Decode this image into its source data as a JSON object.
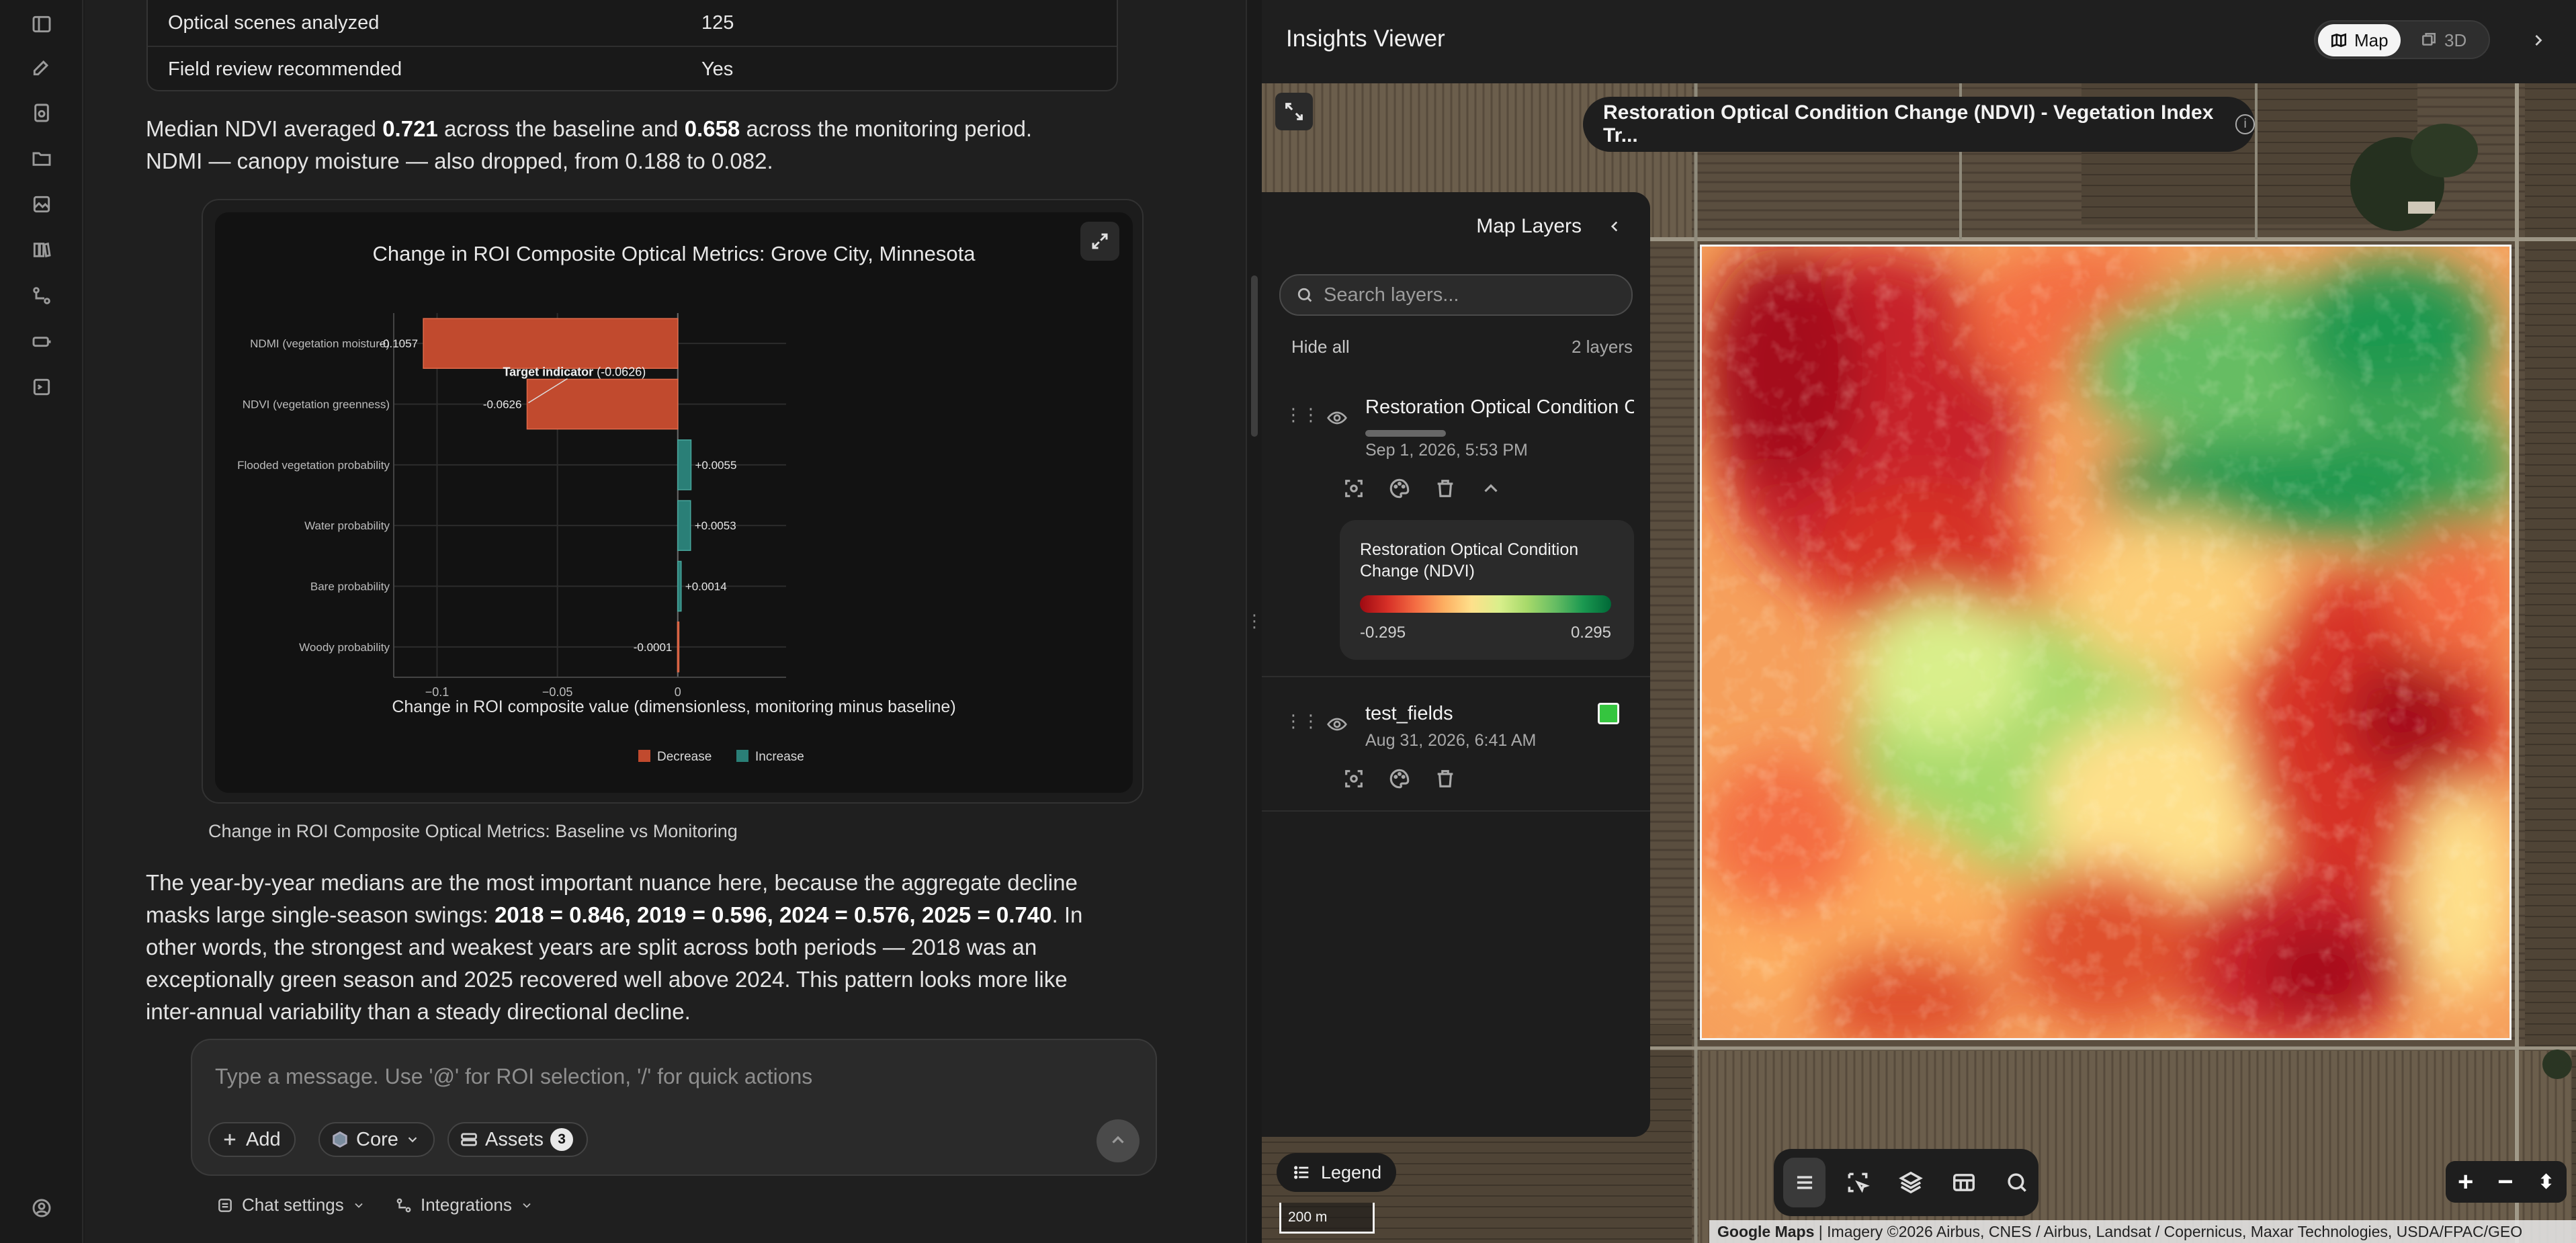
{
  "stats_table": {
    "rows": [
      {
        "label": "Optical scenes analyzed",
        "value": "125"
      },
      {
        "label": "Field review recommended",
        "value": "Yes"
      }
    ]
  },
  "paragraph1": {
    "p1": "Median NDVI averaged ",
    "b1": "0.721",
    "p2": " across the baseline and ",
    "b2": "0.658",
    "p3": " across the monitoring period.",
    "line2": "NDMI — canopy moisture — also dropped, from 0.188 to 0.082."
  },
  "chart_data": {
    "type": "bar",
    "orientation": "horizontal",
    "title": "Change in ROI Composite Optical Metrics: Grove City, Minnesota",
    "xlabel": "Change in ROI composite value (dimensionless, monitoring minus baseline)",
    "ylabel": "",
    "xlim": [
      -0.118,
      0.045
    ],
    "x_ticks": [
      -0.1,
      -0.05,
      0
    ],
    "x_tick_labels": [
      "−0.1",
      "−0.05",
      "0"
    ],
    "categories": [
      "NDMI (vegetation moisture)",
      "NDVI (vegetation greenness)",
      "Flooded vegetation probability",
      "Water probability",
      "Bare probability",
      "Woody probability"
    ],
    "values": [
      -0.1057,
      -0.0626,
      0.0055,
      0.0053,
      0.0014,
      -0.0001
    ],
    "value_labels": [
      "-0.1057",
      "-0.0626",
      "+0.0055",
      "+0.0053",
      "+0.0014",
      "-0.0001"
    ],
    "annotation": {
      "bold": "Target indicator",
      "rest": " (-0.0626)",
      "category": "NDVI (vegetation greenness)"
    },
    "legend": [
      {
        "name": "Decrease",
        "color": "#c14a2e"
      },
      {
        "name": "Increase",
        "color": "#2a7f77"
      }
    ],
    "legend_position": "bottom-center",
    "grid": true,
    "colors": {
      "decrease": "#c14a2e",
      "increase": "#2a7f77"
    }
  },
  "chart_caption": "Change in ROI Composite Optical Metrics: Baseline vs Monitoring",
  "paragraph2": {
    "t1": "The year-by-year medians are the most important nuance here, because the aggregate decline masks large single-season swings: ",
    "b1": "2018 = 0.846, 2019 = 0.596, 2024 = 0.576, 2025 = 0.740",
    "t2": ". In other words, the strongest and weakest years are split across both periods — 2018 was an exceptionally green season and 2025 recovered well above 2024. This pattern looks more like inter-annual variability than a steady directional decline."
  },
  "composer": {
    "placeholder": "Type a message. Use '@' for ROI selection, '/' for quick actions",
    "add_label": "Add",
    "core_label": "Core",
    "assets_label": "Assets",
    "assets_count": "3"
  },
  "footer": {
    "chat_settings": "Chat settings",
    "integrations": "Integrations"
  },
  "insights": {
    "title": "Insights Viewer",
    "map_tab": "Map",
    "tab_3d": "3D",
    "banner": "Restoration Optical Condition Change (NDVI) - Vegetation Index Tr...",
    "layers_panel": {
      "title": "Map Layers",
      "search_placeholder": "Search layers...",
      "hide_all": "Hide all",
      "count": "2 layers",
      "layers": [
        {
          "name": "Restoration Optical Condition Change (NDVI)",
          "date": "Sep 1, 2026, 5:53 PM"
        },
        {
          "name": "test_fields",
          "date": "Aug 31, 2026, 6:41 AM",
          "swatch_color": "#35c53f"
        }
      ],
      "legend": {
        "title": "Restoration Optical Condition Change (NDVI)",
        "min": "-0.295",
        "max": "0.295"
      }
    },
    "legend_button": "Legend",
    "scale": "200 m",
    "attribution_bold": "Google Maps",
    "attribution_rest": " | Imagery ©2026 Airbus, CNES / Airbus, Landsat / Copernicus, Maxar Technologies, USDA/FPAC/GEO"
  }
}
